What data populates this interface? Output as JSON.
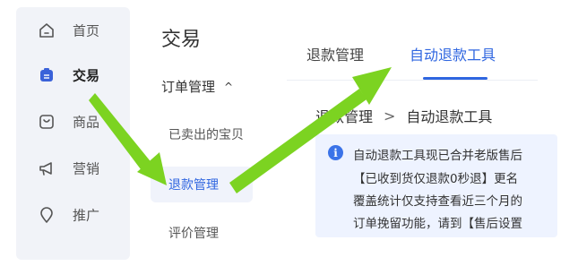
{
  "sidebar": {
    "items": [
      {
        "label": "首页",
        "icon": "home-icon"
      },
      {
        "label": "交易",
        "icon": "trade-icon",
        "active": true
      },
      {
        "label": "商品",
        "icon": "product-icon"
      },
      {
        "label": "营销",
        "icon": "megaphone-icon"
      },
      {
        "label": "推广",
        "icon": "location-pin-icon"
      }
    ]
  },
  "secondary": {
    "title": "交易",
    "group_label": "订单管理",
    "group_caret": "^",
    "items": [
      {
        "label": "已卖出的宝贝"
      },
      {
        "label": "退款管理",
        "active": true
      },
      {
        "label": "评价管理"
      }
    ]
  },
  "tabs": [
    {
      "label": "退款管理",
      "active": false
    },
    {
      "label": "自动退款工具",
      "active": true
    }
  ],
  "breadcrumb": {
    "parent": "退款管理",
    "separator": ">",
    "current": "自动退款工具"
  },
  "notice": {
    "icon": "info-icon",
    "icon_glyph": "i",
    "lines": [
      "自动退款工具现已合并老版售后",
      "【已收到货仅退款0秒退】更名",
      "覆盖统计仅支持查看近三个月的",
      "订单挽留功能，请到【售后设置"
    ]
  },
  "colors": {
    "accent": "#2f66e0",
    "sidebar_bg": "#f1f3f8",
    "notice_bg": "#eef3ff",
    "arrow": "#7cd321",
    "active_icon": "#3a62d9"
  }
}
